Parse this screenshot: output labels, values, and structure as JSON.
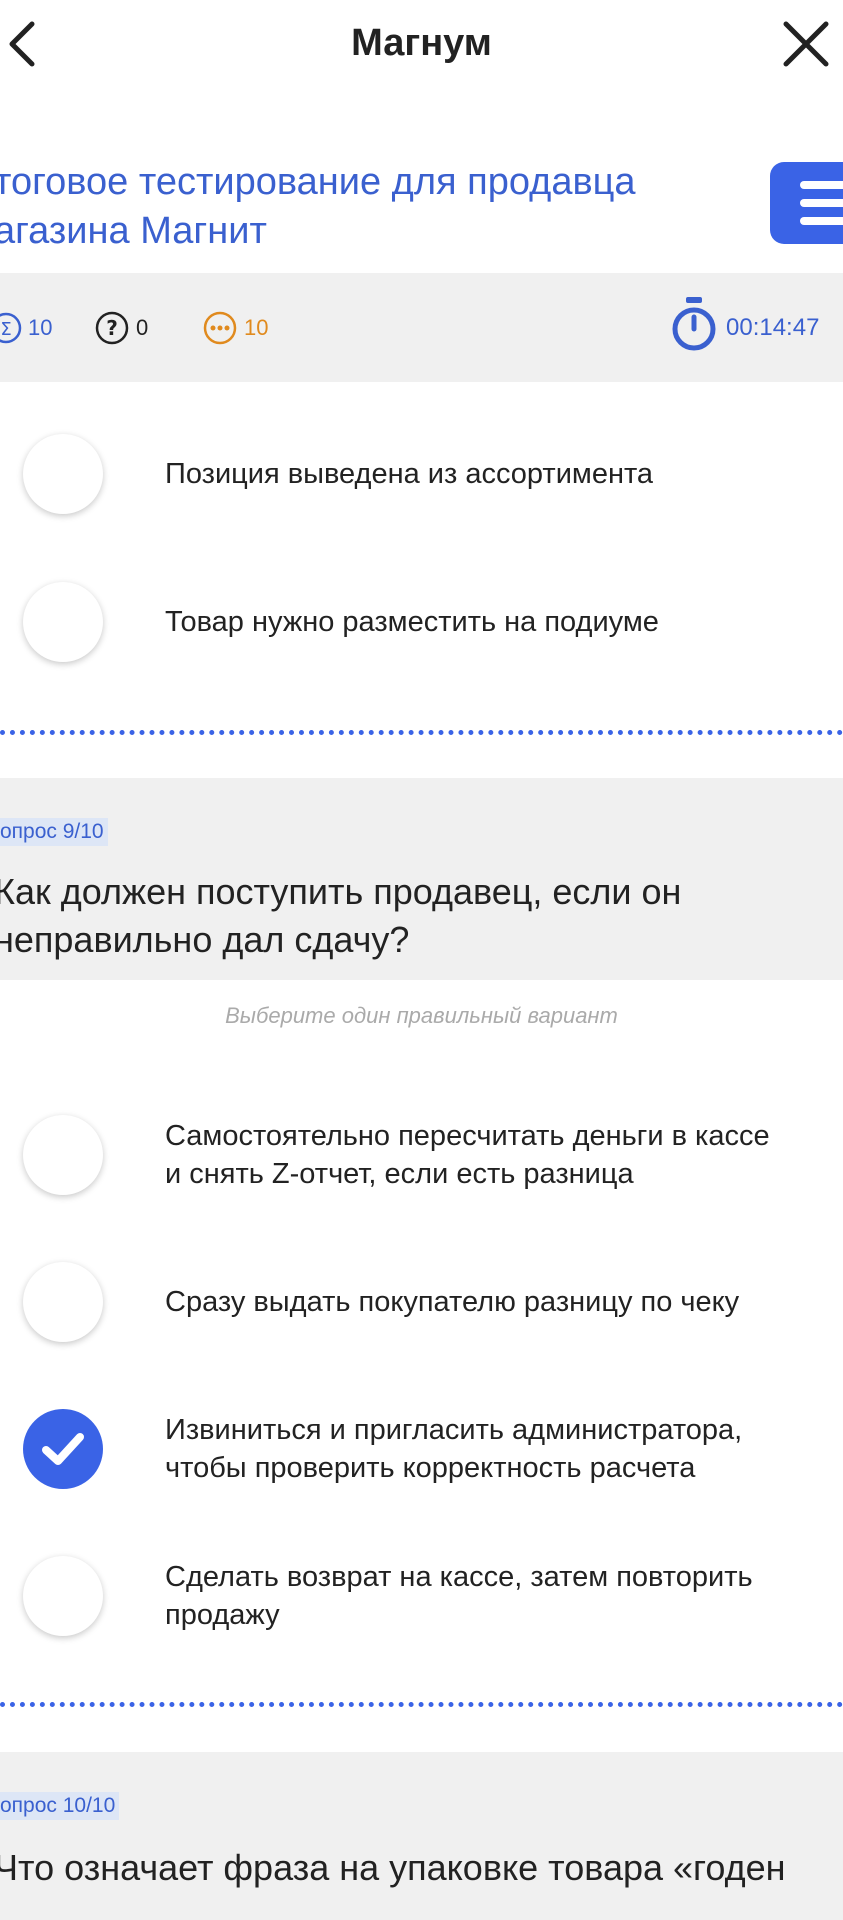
{
  "header": {
    "title": "Магнум",
    "back_icon": "chevron-left-icon",
    "close_icon": "close-icon"
  },
  "test": {
    "title_line1": "тоговое тестирование для продавца",
    "title_line2": "агазина Магнит"
  },
  "stats": {
    "total": "10",
    "unanswered": "0",
    "pending": "10",
    "timer": "00:14:47"
  },
  "prev_question": {
    "options": [
      {
        "label": "Позиция выведена из ассортимента",
        "checked": false
      },
      {
        "label": "Товар нужно разместить на подиуме",
        "checked": false
      }
    ]
  },
  "question9": {
    "label": "опрос 9/10",
    "text_line1": "Как должен поступить продавец, если он",
    "text_line2": "неправильно дал сдачу?",
    "hint": "Выберите один правильный вариант",
    "options": [
      {
        "line1": "Самостоятельно пересчитать деньги в кассе",
        "line2": "и снять Z-отчет, если есть разница",
        "checked": false
      },
      {
        "line1": "Сразу выдать покупателю разницу по чеку",
        "line2": "",
        "checked": false
      },
      {
        "line1": "Извиниться и пригласить администратора,",
        "line2": "чтобы проверить корректность расчета",
        "checked": true
      },
      {
        "line1": "Сделать возврат на кассе, затем повторить",
        "line2": "продажу",
        "checked": false
      }
    ]
  },
  "question10": {
    "label": "опрос 10/10",
    "text_line1": "Что означает фраза на упаковке товара «годен"
  },
  "colors": {
    "accent": "#3a63e6",
    "pending": "#e08a1e",
    "stats_bg": "#f0f0f0"
  }
}
